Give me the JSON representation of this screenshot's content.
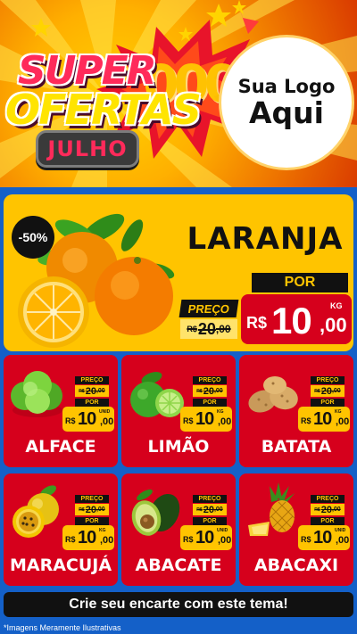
{
  "header": {
    "title_line1": "SUPER",
    "title_line2": "OFERTAS",
    "month": "JULHO",
    "decor": "000",
    "logo_line1": "Sua Logo",
    "logo_line2": "Aqui"
  },
  "featured": {
    "discount": "-50%",
    "name": "LARANJA",
    "preco_label": "PREÇO",
    "old_currency": "R$",
    "old_int": "20",
    "old_dec": ",00",
    "por_label": "POR",
    "currency": "R$",
    "price_int": "10",
    "price_dec": ",00",
    "unit": "KG",
    "icon": "orange-icon"
  },
  "products": [
    {
      "name": "ALFACE",
      "preco_label": "PREÇO",
      "old_currency": "R$",
      "old_int": "20",
      "old_dec": ",00",
      "por_label": "POR",
      "currency": "R$",
      "price_int": "10",
      "price_dec": ",00",
      "unit": "UNID",
      "icon": "lettuce-icon"
    },
    {
      "name": "LIMÃO",
      "preco_label": "PREÇO",
      "old_currency": "R$",
      "old_int": "20",
      "old_dec": ",00",
      "por_label": "POR",
      "currency": "R$",
      "price_int": "10",
      "price_dec": ",00",
      "unit": "KG",
      "icon": "lime-icon"
    },
    {
      "name": "BATATA",
      "preco_label": "PREÇO",
      "old_currency": "R$",
      "old_int": "20",
      "old_dec": ",00",
      "por_label": "POR",
      "currency": "R$",
      "price_int": "10",
      "price_dec": ",00",
      "unit": "KG",
      "icon": "potato-icon"
    },
    {
      "name": "MARACUJÁ",
      "preco_label": "PREÇO",
      "old_currency": "R$",
      "old_int": "20",
      "old_dec": ",00",
      "por_label": "POR",
      "currency": "R$",
      "price_int": "10",
      "price_dec": ",00",
      "unit": "KG",
      "icon": "passion-fruit-icon"
    },
    {
      "name": "ABACATE",
      "preco_label": "PREÇO",
      "old_currency": "R$",
      "old_int": "20",
      "old_dec": ",00",
      "por_label": "POR",
      "currency": "R$",
      "price_int": "10",
      "price_dec": ",00",
      "unit": "UNID",
      "icon": "avocado-icon"
    },
    {
      "name": "ABACAXI",
      "preco_label": "PREÇO",
      "old_currency": "R$",
      "old_int": "20",
      "old_dec": ",00",
      "por_label": "POR",
      "currency": "R$",
      "price_int": "10",
      "price_dec": ",00",
      "unit": "UNID",
      "icon": "pineapple-icon"
    }
  ],
  "footer": {
    "cta": "Crie seu encarte com este tema!",
    "disclaimer": "*Imagens Meramente Ilustrativas"
  },
  "colors": {
    "background_blue": "#1460c8",
    "card_red": "#d6001c",
    "accent_yellow": "#ffc400",
    "dark": "#111111"
  }
}
